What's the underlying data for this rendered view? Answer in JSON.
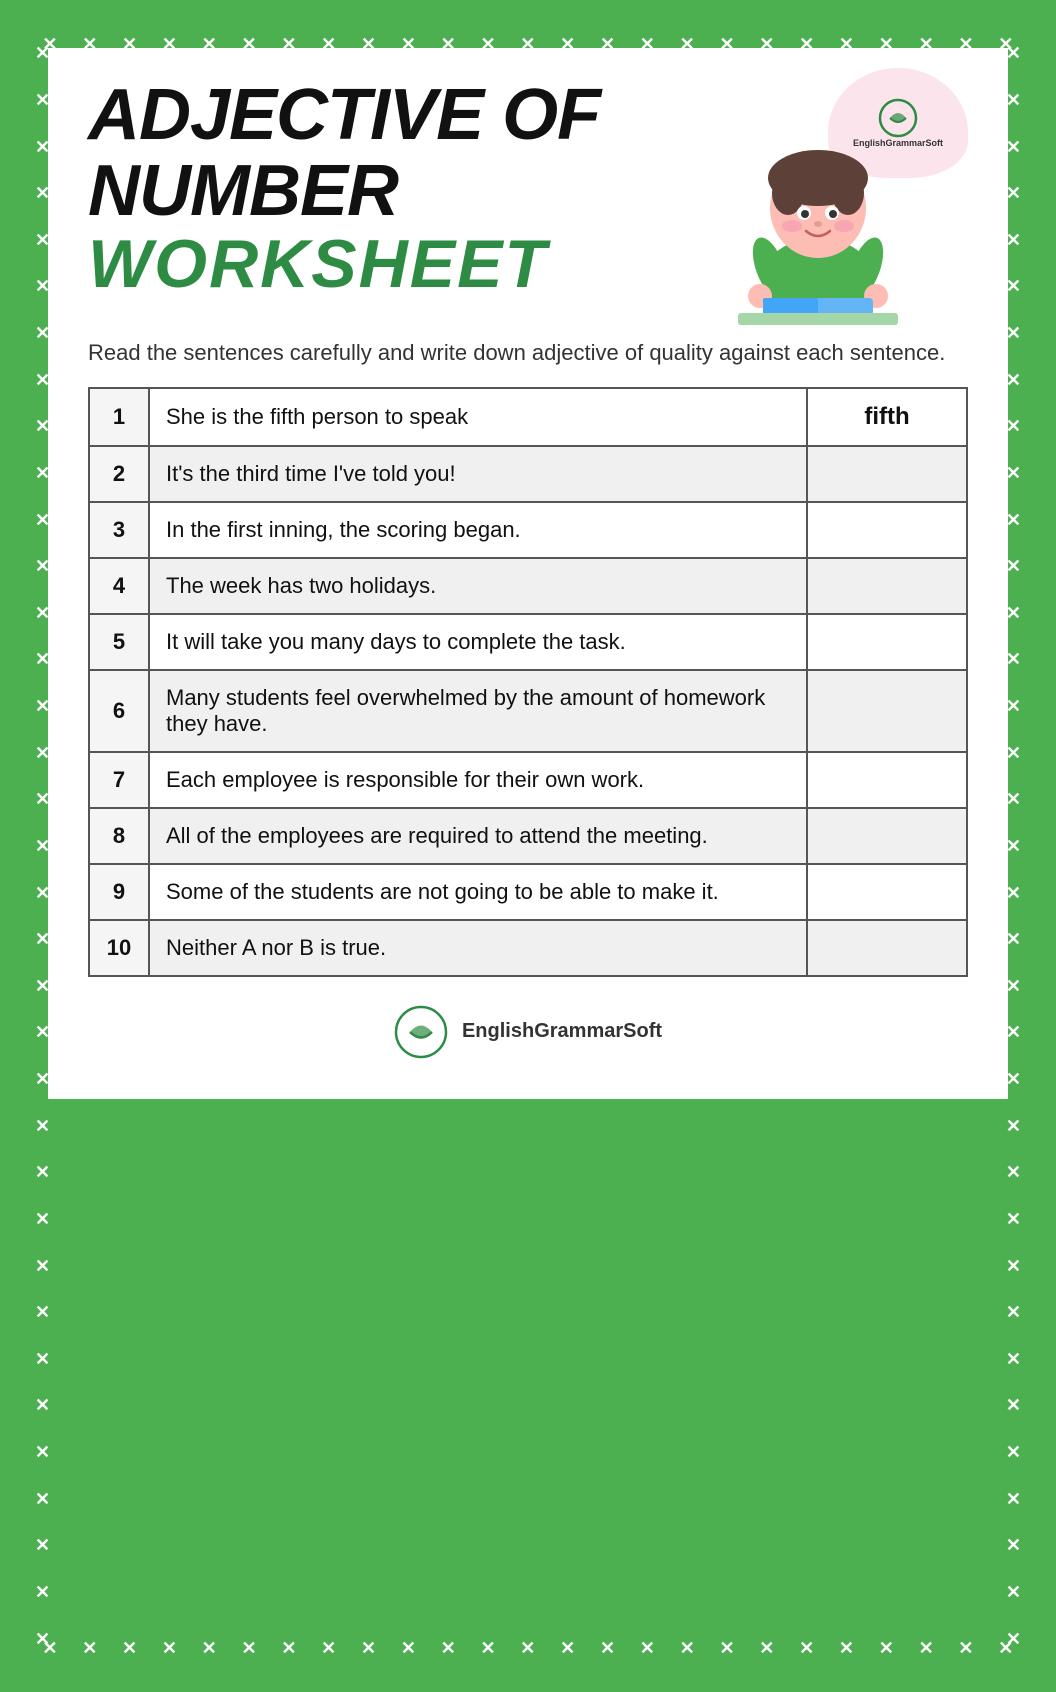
{
  "page": {
    "background_color": "#4caf50",
    "title_line1": "ADJECTIVE OF",
    "title_line2": "NUMBER",
    "title_worksheet": "WORKSHEET",
    "instructions": "Read the sentences carefully and write down adjective of quality against each sentence.",
    "brand": "EnglishGrammarSoft",
    "table": {
      "rows": [
        {
          "num": 1,
          "sentence": "She is the fifth person to speak",
          "answer": "fifth",
          "shaded": false
        },
        {
          "num": 2,
          "sentence": "It's the third time I've told you!",
          "answer": "",
          "shaded": true
        },
        {
          "num": 3,
          "sentence": "In the first inning, the scoring began.",
          "answer": "",
          "shaded": false
        },
        {
          "num": 4,
          "sentence": "The week has two holidays.",
          "answer": "",
          "shaded": true
        },
        {
          "num": 5,
          "sentence": "It will take you many days to complete the task.",
          "answer": "",
          "shaded": false
        },
        {
          "num": 6,
          "sentence": "Many students feel overwhelmed by the amount of homework they have.",
          "answer": "",
          "shaded": true
        },
        {
          "num": 7,
          "sentence": "Each employee is responsible for their own work.",
          "answer": "",
          "shaded": false
        },
        {
          "num": 8,
          "sentence": "All of the employees are required to attend the meeting.",
          "answer": "",
          "shaded": true
        },
        {
          "num": 9,
          "sentence": "Some of the students are not going to be able to make it.",
          "answer": "",
          "shaded": false
        },
        {
          "num": 10,
          "sentence": "Neither A nor B is true.",
          "answer": "",
          "shaded": true
        }
      ]
    }
  }
}
